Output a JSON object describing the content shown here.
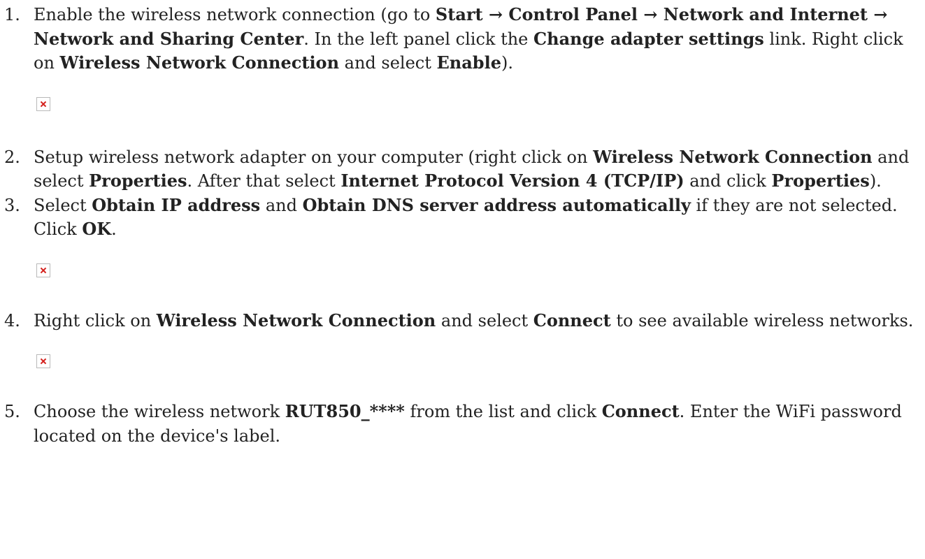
{
  "steps": [
    {
      "number": "1.",
      "segments": [
        {
          "text": "Enable the wireless network connection (go to ",
          "bold": false
        },
        {
          "text": "Start → Control Panel → Network and Internet → Network and Sharing Center",
          "bold": true
        },
        {
          "text": ". In the left panel click the ",
          "bold": false
        },
        {
          "text": "Change adapter settings",
          "bold": true
        },
        {
          "text": " link. Right click on ",
          "bold": false
        },
        {
          "text": "Wireless Network Connection",
          "bold": true
        },
        {
          "text": " and select ",
          "bold": false
        },
        {
          "text": "Enable",
          "bold": true
        },
        {
          "text": ").",
          "bold": false
        }
      ]
    },
    {
      "number": "2.",
      "segments": [
        {
          "text": "Setup wireless network adapter on your computer (right click on ",
          "bold": false
        },
        {
          "text": "Wireless Network Connection",
          "bold": true
        },
        {
          "text": " and select ",
          "bold": false
        },
        {
          "text": "Properties",
          "bold": true
        },
        {
          "text": ". After that select ",
          "bold": false
        },
        {
          "text": "Internet Protocol Version 4 (TCP/IP)",
          "bold": true
        },
        {
          "text": " and click ",
          "bold": false
        },
        {
          "text": "Properties",
          "bold": true
        },
        {
          "text": ").",
          "bold": false
        }
      ]
    },
    {
      "number": "3.",
      "segments": [
        {
          "text": "Select ",
          "bold": false
        },
        {
          "text": "Obtain IP address",
          "bold": true
        },
        {
          "text": " and ",
          "bold": false
        },
        {
          "text": "Obtain DNS server address automatically",
          "bold": true
        },
        {
          "text": " if they are not selected. Click ",
          "bold": false
        },
        {
          "text": "OK",
          "bold": true
        },
        {
          "text": ".",
          "bold": false
        }
      ]
    },
    {
      "number": "4.",
      "segments": [
        {
          "text": "Right click on ",
          "bold": false
        },
        {
          "text": "Wireless Network Connection",
          "bold": true
        },
        {
          "text": " and select ",
          "bold": false
        },
        {
          "text": "Connect",
          "bold": true
        },
        {
          "text": " to see available wireless networks.",
          "bold": false
        }
      ]
    },
    {
      "number": "5.",
      "segments": [
        {
          "text": "Choose the wireless network ",
          "bold": false
        },
        {
          "text": "RUT850_****",
          "bold": true
        },
        {
          "text": " from the list and click ",
          "bold": false
        },
        {
          "text": "Connect",
          "bold": true
        },
        {
          "text": ". Enter the WiFi password located on the device's label.",
          "bold": false
        }
      ]
    }
  ],
  "images": [
    {
      "icon": "broken-image-icon"
    },
    {
      "icon": "broken-image-icon"
    },
    {
      "icon": "broken-image-icon"
    }
  ],
  "colors": {
    "text": "#222222",
    "broken_image_border": "#b9b9b9",
    "broken_image_cross": "#d4201c"
  }
}
